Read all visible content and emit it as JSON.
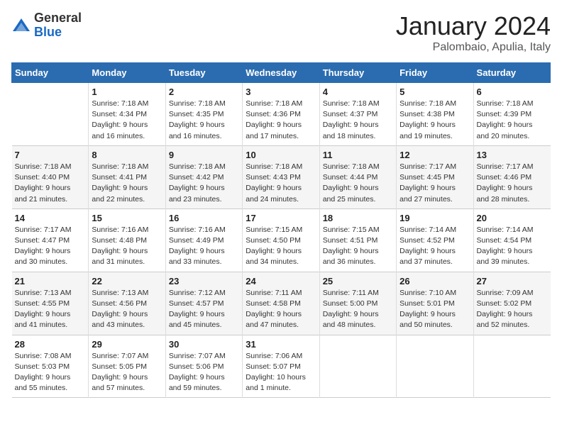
{
  "header": {
    "logo_general": "General",
    "logo_blue": "Blue",
    "title": "January 2024",
    "subtitle": "Palombaio, Apulia, Italy"
  },
  "columns": [
    "Sunday",
    "Monday",
    "Tuesday",
    "Wednesday",
    "Thursday",
    "Friday",
    "Saturday"
  ],
  "rows": [
    [
      {
        "num": "",
        "info": ""
      },
      {
        "num": "1",
        "info": "Sunrise: 7:18 AM\nSunset: 4:34 PM\nDaylight: 9 hours\nand 16 minutes."
      },
      {
        "num": "2",
        "info": "Sunrise: 7:18 AM\nSunset: 4:35 PM\nDaylight: 9 hours\nand 16 minutes."
      },
      {
        "num": "3",
        "info": "Sunrise: 7:18 AM\nSunset: 4:36 PM\nDaylight: 9 hours\nand 17 minutes."
      },
      {
        "num": "4",
        "info": "Sunrise: 7:18 AM\nSunset: 4:37 PM\nDaylight: 9 hours\nand 18 minutes."
      },
      {
        "num": "5",
        "info": "Sunrise: 7:18 AM\nSunset: 4:38 PM\nDaylight: 9 hours\nand 19 minutes."
      },
      {
        "num": "6",
        "info": "Sunrise: 7:18 AM\nSunset: 4:39 PM\nDaylight: 9 hours\nand 20 minutes."
      }
    ],
    [
      {
        "num": "7",
        "info": "Sunrise: 7:18 AM\nSunset: 4:40 PM\nDaylight: 9 hours\nand 21 minutes."
      },
      {
        "num": "8",
        "info": "Sunrise: 7:18 AM\nSunset: 4:41 PM\nDaylight: 9 hours\nand 22 minutes."
      },
      {
        "num": "9",
        "info": "Sunrise: 7:18 AM\nSunset: 4:42 PM\nDaylight: 9 hours\nand 23 minutes."
      },
      {
        "num": "10",
        "info": "Sunrise: 7:18 AM\nSunset: 4:43 PM\nDaylight: 9 hours\nand 24 minutes."
      },
      {
        "num": "11",
        "info": "Sunrise: 7:18 AM\nSunset: 4:44 PM\nDaylight: 9 hours\nand 25 minutes."
      },
      {
        "num": "12",
        "info": "Sunrise: 7:17 AM\nSunset: 4:45 PM\nDaylight: 9 hours\nand 27 minutes."
      },
      {
        "num": "13",
        "info": "Sunrise: 7:17 AM\nSunset: 4:46 PM\nDaylight: 9 hours\nand 28 minutes."
      }
    ],
    [
      {
        "num": "14",
        "info": "Sunrise: 7:17 AM\nSunset: 4:47 PM\nDaylight: 9 hours\nand 30 minutes."
      },
      {
        "num": "15",
        "info": "Sunrise: 7:16 AM\nSunset: 4:48 PM\nDaylight: 9 hours\nand 31 minutes."
      },
      {
        "num": "16",
        "info": "Sunrise: 7:16 AM\nSunset: 4:49 PM\nDaylight: 9 hours\nand 33 minutes."
      },
      {
        "num": "17",
        "info": "Sunrise: 7:15 AM\nSunset: 4:50 PM\nDaylight: 9 hours\nand 34 minutes."
      },
      {
        "num": "18",
        "info": "Sunrise: 7:15 AM\nSunset: 4:51 PM\nDaylight: 9 hours\nand 36 minutes."
      },
      {
        "num": "19",
        "info": "Sunrise: 7:14 AM\nSunset: 4:52 PM\nDaylight: 9 hours\nand 37 minutes."
      },
      {
        "num": "20",
        "info": "Sunrise: 7:14 AM\nSunset: 4:54 PM\nDaylight: 9 hours\nand 39 minutes."
      }
    ],
    [
      {
        "num": "21",
        "info": "Sunrise: 7:13 AM\nSunset: 4:55 PM\nDaylight: 9 hours\nand 41 minutes."
      },
      {
        "num": "22",
        "info": "Sunrise: 7:13 AM\nSunset: 4:56 PM\nDaylight: 9 hours\nand 43 minutes."
      },
      {
        "num": "23",
        "info": "Sunrise: 7:12 AM\nSunset: 4:57 PM\nDaylight: 9 hours\nand 45 minutes."
      },
      {
        "num": "24",
        "info": "Sunrise: 7:11 AM\nSunset: 4:58 PM\nDaylight: 9 hours\nand 47 minutes."
      },
      {
        "num": "25",
        "info": "Sunrise: 7:11 AM\nSunset: 5:00 PM\nDaylight: 9 hours\nand 48 minutes."
      },
      {
        "num": "26",
        "info": "Sunrise: 7:10 AM\nSunset: 5:01 PM\nDaylight: 9 hours\nand 50 minutes."
      },
      {
        "num": "27",
        "info": "Sunrise: 7:09 AM\nSunset: 5:02 PM\nDaylight: 9 hours\nand 52 minutes."
      }
    ],
    [
      {
        "num": "28",
        "info": "Sunrise: 7:08 AM\nSunset: 5:03 PM\nDaylight: 9 hours\nand 55 minutes."
      },
      {
        "num": "29",
        "info": "Sunrise: 7:07 AM\nSunset: 5:05 PM\nDaylight: 9 hours\nand 57 minutes."
      },
      {
        "num": "30",
        "info": "Sunrise: 7:07 AM\nSunset: 5:06 PM\nDaylight: 9 hours\nand 59 minutes."
      },
      {
        "num": "31",
        "info": "Sunrise: 7:06 AM\nSunset: 5:07 PM\nDaylight: 10 hours\nand 1 minute."
      },
      {
        "num": "",
        "info": ""
      },
      {
        "num": "",
        "info": ""
      },
      {
        "num": "",
        "info": ""
      }
    ]
  ]
}
